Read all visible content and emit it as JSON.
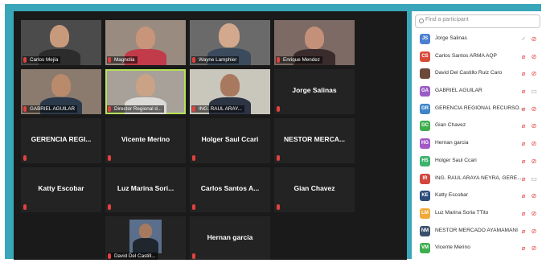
{
  "gallery": {
    "tiles": [
      {
        "label": "Carlos Mejía",
        "kind": "video"
      },
      {
        "label": "Magnolia",
        "kind": "video"
      },
      {
        "label": "Wayne Lamphier",
        "kind": "video"
      },
      {
        "label": "Enrique Mendez",
        "kind": "video"
      },
      {
        "label": "GABRIEL AGUILAR",
        "kind": "video"
      },
      {
        "label": "Director Regional d...",
        "kind": "video",
        "active": true
      },
      {
        "label": "ING. RAUL ARAY...",
        "kind": "video"
      },
      {
        "label": "Jorge Salinas",
        "kind": "name"
      },
      {
        "label": "GERENCIA REGI...",
        "kind": "name"
      },
      {
        "label": "Vicente Merino",
        "kind": "name"
      },
      {
        "label": "Holger Saul Ccari",
        "kind": "name"
      },
      {
        "label": "NESTOR MERCA...",
        "kind": "name"
      },
      {
        "label": "Katty Escobar",
        "kind": "name"
      },
      {
        "label": "Luz Marina Sori...",
        "kind": "name"
      },
      {
        "label": "Carlos Santos A...",
        "kind": "name"
      },
      {
        "label": "Gian Chavez",
        "kind": "name"
      },
      {
        "label": "David Del Castill...",
        "kind": "video"
      },
      {
        "label": "Hernan garcia",
        "kind": "name"
      }
    ]
  },
  "participants": {
    "search_placeholder": "Find a participant",
    "list": [
      {
        "initials": "JS",
        "name": "Jorge Salinas",
        "color": "#4a7fd0",
        "mic": "on",
        "cam": "off"
      },
      {
        "initials": "CS",
        "name": "Carlos Santos ARMA AQP",
        "color": "#d94a3b",
        "mic": "off",
        "cam": "off"
      },
      {
        "initials": "",
        "name": "David Del Castillo Ruiz Caro",
        "color": "#6b4a3a",
        "mic": "off",
        "cam": "off"
      },
      {
        "initials": "GA",
        "name": "GABRIEL AGUILAR",
        "color": "#9a5cc7",
        "mic": "off",
        "cam": "on"
      },
      {
        "initials": "GR",
        "name": "GERENCIA REGIONAL RECURSO...",
        "color": "#3e86c9",
        "mic": "off",
        "cam": "off"
      },
      {
        "initials": "GC",
        "name": "Gian Chavez",
        "color": "#3fae4f",
        "mic": "off",
        "cam": "off"
      },
      {
        "initials": "HG",
        "name": "Hernan garcia",
        "color": "#a25ac7",
        "mic": "off",
        "cam": "off"
      },
      {
        "initials": "HS",
        "name": "Holger Saul Ccari",
        "color": "#3bb36c",
        "mic": "off",
        "cam": "off"
      },
      {
        "initials": "IR",
        "name": "ING. RAUL ARAYA NEYRA, GERE...",
        "color": "#d2483e",
        "mic": "off",
        "cam": "on"
      },
      {
        "initials": "KE",
        "name": "Katty Escobar",
        "color": "#2e4d7a",
        "mic": "off",
        "cam": "off"
      },
      {
        "initials": "LM",
        "name": "Luz Marina Soria TTito",
        "color": "#f1a93a",
        "mic": "off",
        "cam": "off"
      },
      {
        "initials": "NM",
        "name": "NESTOR MERCADO AYAMAMANI",
        "color": "#3a4f6b",
        "mic": "off",
        "cam": "off"
      },
      {
        "initials": "VM",
        "name": "Vicente Merino",
        "color": "#3fae4f",
        "mic": "off",
        "cam": "off"
      }
    ]
  }
}
